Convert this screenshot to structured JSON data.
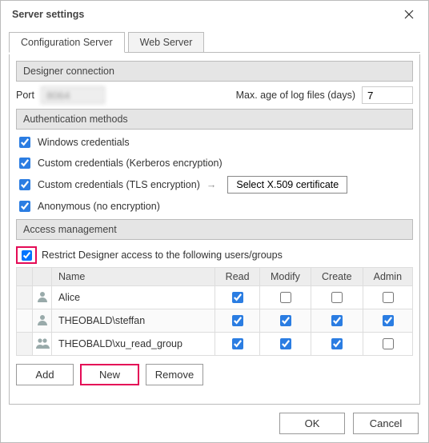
{
  "window": {
    "title": "Server settings"
  },
  "tabs": {
    "config": "Configuration Server",
    "web": "Web Server"
  },
  "designer": {
    "header": "Designer connection",
    "port_label": "Port",
    "port_value": "8064",
    "maxage_label": "Max. age of log files (days)",
    "maxage_value": "7"
  },
  "auth": {
    "header": "Authentication methods",
    "windows": "Windows credentials",
    "kerberos": "Custom credentials (Kerberos encryption)",
    "tls": "Custom credentials (TLS encryption)",
    "cert_button": "Select X.509 certificate",
    "anonymous": "Anonymous (no encryption)"
  },
  "access": {
    "header": "Access management",
    "restrict": "Restrict Designer access to the following users/groups",
    "columns": {
      "name": "Name",
      "read": "Read",
      "modify": "Modify",
      "create": "Create",
      "admin": "Admin"
    },
    "rows": [
      {
        "icon": "user",
        "name": "Alice",
        "read": true,
        "modify": false,
        "create": false,
        "admin": false
      },
      {
        "icon": "user",
        "name": "THEOBALD\\steffan",
        "read": true,
        "modify": true,
        "create": true,
        "admin": true
      },
      {
        "icon": "group",
        "name": "THEOBALD\\xu_read_group",
        "read": true,
        "modify": true,
        "create": true,
        "admin": false
      }
    ],
    "buttons": {
      "add": "Add",
      "new": "New",
      "remove": "Remove"
    }
  },
  "footer": {
    "ok": "OK",
    "cancel": "Cancel"
  }
}
